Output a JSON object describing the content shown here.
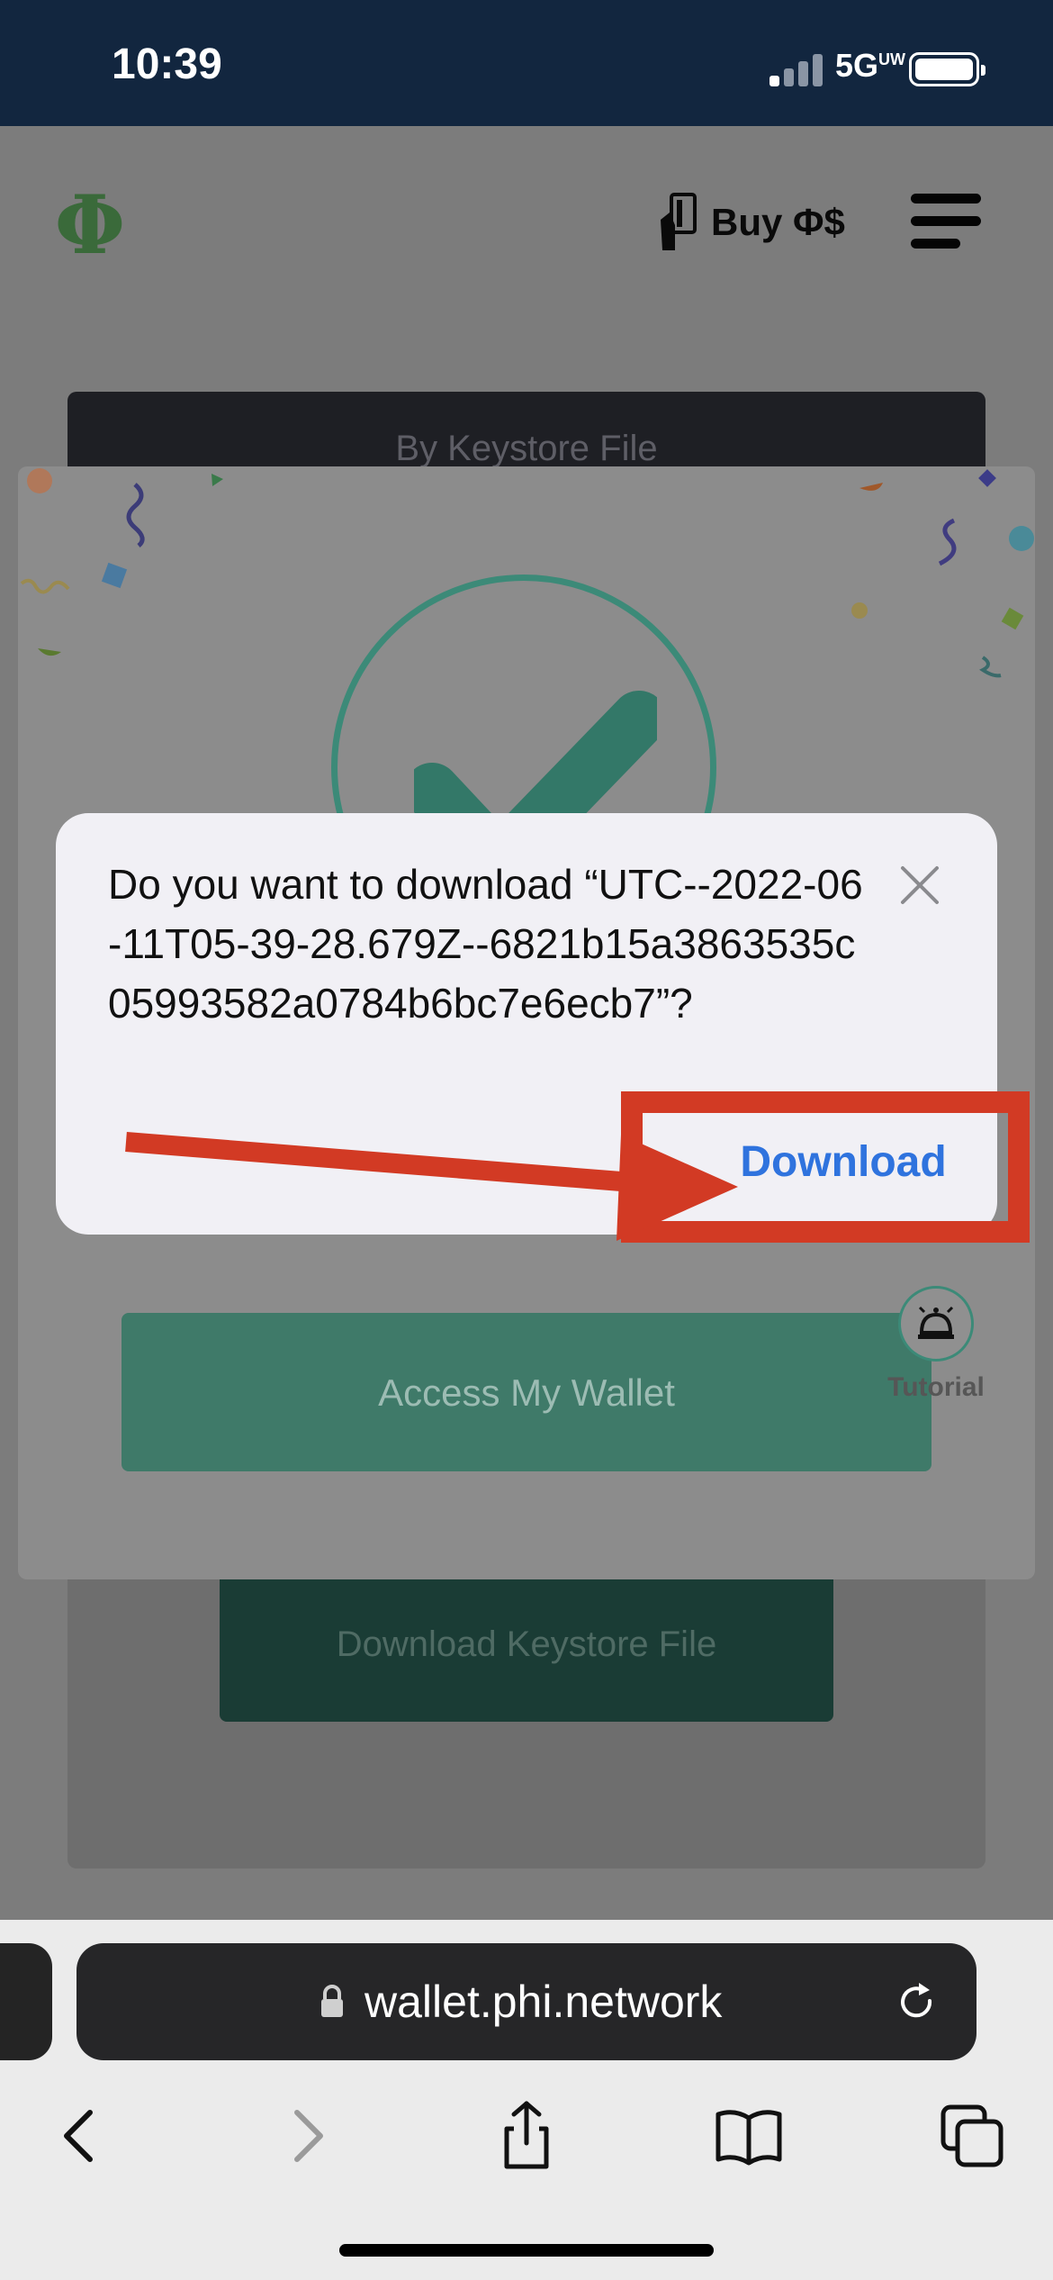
{
  "status_bar": {
    "time": "10:39",
    "network": "5G",
    "network_sup": "UW"
  },
  "header": {
    "logo_text": "Φ",
    "buy_label": "Buy Φ$"
  },
  "background_page": {
    "keystore_tab_label": "By Keystore File",
    "download_keystore_label": "Download Keystore File"
  },
  "success_modal": {
    "access_wallet_label": "Access My Wallet",
    "tutorial_label": "Tutorial",
    "accent_color": "#3c8a78"
  },
  "download_dialog": {
    "message": "Do you want to download “UTC--2022-06-11T05-39-28.679Z--6821b15a3863535c05993582a0784b6bc7e6ecb7”?",
    "download_label": "Download",
    "download_color": "#2f73de"
  },
  "annotation": {
    "highlight_color": "#d23a24"
  },
  "browser": {
    "url": "wallet.phi.network"
  }
}
